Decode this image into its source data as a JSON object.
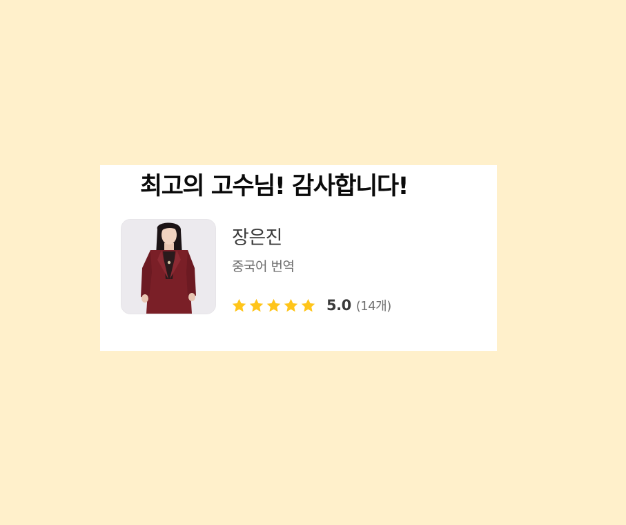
{
  "headline": "최고의 고수님! 감사합니다!",
  "profile": {
    "name": "장은진",
    "category": "중국어 번역",
    "rating": {
      "stars": 5,
      "max_stars": 5,
      "score": "5.0",
      "review_count": "(14개)"
    }
  },
  "colors": {
    "background": "#fff0cb",
    "card": "#ffffff",
    "star": "#ffc51a",
    "text_primary": "#3a3a3a",
    "text_secondary": "#6e6e6e"
  }
}
